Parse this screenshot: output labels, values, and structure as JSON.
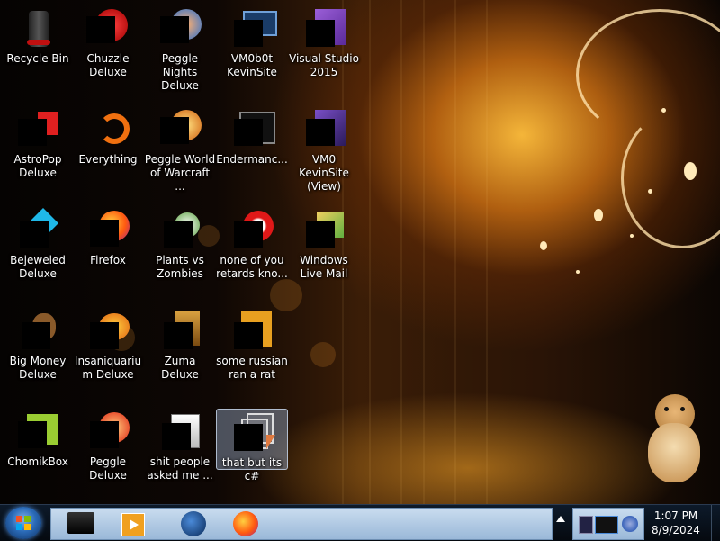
{
  "desktop": {
    "icons": [
      {
        "label": "Recycle Bin",
        "icon": "recycle-bin-icon"
      },
      {
        "label": "Chuzzle Deluxe",
        "icon": "chuzzle-icon"
      },
      {
        "label": "Peggle Nights Deluxe",
        "icon": "peggle-nights-icon"
      },
      {
        "label": "VM0b0t KevinSite",
        "icon": "vm-monitor-icon"
      },
      {
        "label": "Visual Studio 2015",
        "icon": "visual-studio-icon"
      },
      {
        "label": "AstroPop Deluxe",
        "icon": "astropop-icon"
      },
      {
        "label": "Everything",
        "icon": "everything-search-icon"
      },
      {
        "label": "Peggle World of Warcraft ...",
        "icon": "peggle-wow-icon"
      },
      {
        "label": "Endermanc...",
        "icon": "terminal-icon"
      },
      {
        "label": "VM0 KevinSite (View)",
        "icon": "vm-view-icon"
      },
      {
        "label": "Bejeweled Deluxe",
        "icon": "bejeweled-icon"
      },
      {
        "label": "Firefox",
        "icon": "firefox-icon"
      },
      {
        "label": "Plants vs Zombies",
        "icon": "plants-vs-zombies-icon"
      },
      {
        "label": "none of you retards kno...",
        "icon": "red-app-icon"
      },
      {
        "label": "Windows Live Mail",
        "icon": "windows-live-mail-icon"
      },
      {
        "label": "Big Money Deluxe",
        "icon": "big-money-icon"
      },
      {
        "label": "Insaniquarium Deluxe",
        "icon": "insaniquarium-icon"
      },
      {
        "label": "Zuma Deluxe",
        "icon": "zuma-icon"
      },
      {
        "label": "some russian ran a rat",
        "icon": "document-icon"
      },
      {
        "label": "ChomikBox",
        "icon": "chomikbox-icon"
      },
      {
        "label": "Peggle Deluxe",
        "icon": "peggle-icon"
      },
      {
        "label": "shit people asked me ...",
        "icon": "folder-icon"
      },
      {
        "label": "that but its c#",
        "icon": "shortcut-copy-icon"
      }
    ]
  },
  "taskbar": {
    "start": "windows-start-icon",
    "pinned": [
      "desktop-app-icon",
      "media-player-icon",
      "globe-icon",
      "firefox-icon"
    ],
    "tray_icons": [
      "network-icon",
      "monitor-icon",
      "edge-icon"
    ],
    "clock": {
      "time": "1:07 PM",
      "date": "8/9/2024"
    }
  }
}
